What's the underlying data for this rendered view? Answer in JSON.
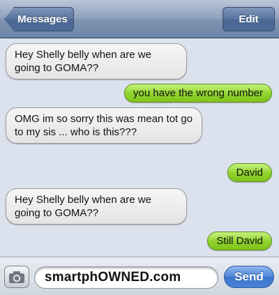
{
  "navbar": {
    "back_label": "Messages",
    "edit_label": "Edit"
  },
  "messages": [
    {
      "direction": "incoming",
      "text": "Hey Shelly belly when are we going to GOMA??"
    },
    {
      "direction": "outgoing",
      "text": "you have the wrong number"
    },
    {
      "direction": "incoming",
      "text": "OMG im so sorry this was mean tot go to my sis ... who is this???"
    },
    {
      "direction": "outgoing",
      "text": "David"
    },
    {
      "direction": "incoming",
      "text": "Hey Shelly belly when are we going to GOMA??"
    },
    {
      "direction": "outgoing",
      "text": "Still David"
    }
  ],
  "input_bar": {
    "camera_icon": "camera-icon",
    "field_value": "smartphOWNED.com",
    "send_label": "Send"
  },
  "colors": {
    "incoming_bubble": "#e8e8e8",
    "outgoing_bubble": "#8fd32c",
    "background": "#dbe2ed",
    "send_button": "#4a82d6"
  }
}
